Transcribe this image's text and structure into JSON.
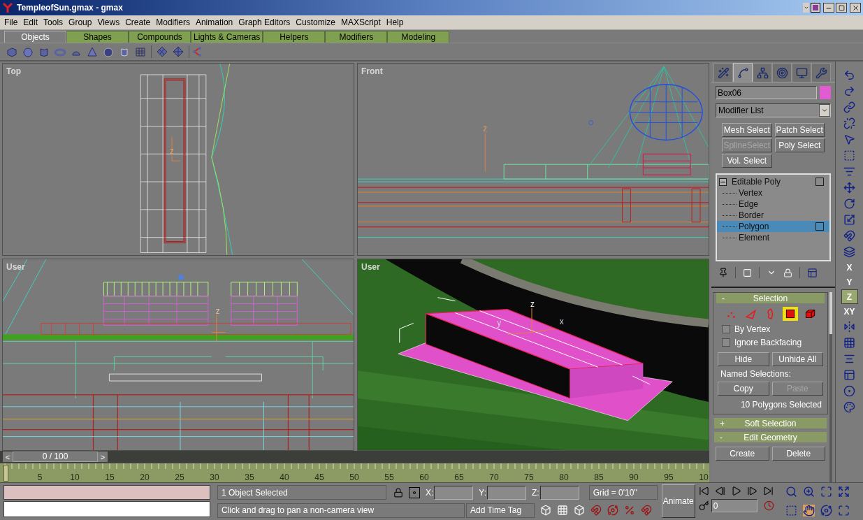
{
  "window": {
    "title": "TempleofSun.gmax - gmax"
  },
  "menu": [
    "File",
    "Edit",
    "Tools",
    "Group",
    "Views",
    "Create",
    "Modifiers",
    "Animation",
    "Graph Editors",
    "Customize",
    "MAXScript",
    "Help"
  ],
  "tabs": [
    {
      "label": "Objects",
      "selected": true
    },
    {
      "label": "Shapes",
      "selected": false
    },
    {
      "label": "Compounds",
      "selected": false
    },
    {
      "label": "Lights & Cameras",
      "selected": false
    },
    {
      "label": "Helpers",
      "selected": false
    },
    {
      "label": "Modifiers",
      "selected": false
    },
    {
      "label": "Modeling",
      "selected": false
    }
  ],
  "viewports": [
    {
      "label": "Top",
      "kind": "top",
      "gizmo_labels": [
        "z"
      ]
    },
    {
      "label": "Front",
      "kind": "front",
      "gizmo_labels": [
        "z"
      ]
    },
    {
      "label": "User",
      "kind": "user",
      "gizmo_labels": [
        "z"
      ]
    },
    {
      "label": "User",
      "kind": "shaded",
      "gizmo_labels": [
        "z",
        "y",
        "x"
      ]
    }
  ],
  "command_panel": {
    "tabs": [
      {
        "kind": "create",
        "selected": false
      },
      {
        "kind": "modify",
        "selected": true
      },
      {
        "kind": "hierarchy",
        "selected": false
      },
      {
        "kind": "motion",
        "selected": false
      },
      {
        "kind": "display",
        "selected": false
      },
      {
        "kind": "utilities",
        "selected": false
      }
    ],
    "object_name": "Box06",
    "object_swatch": {
      "color": "#e05cd0"
    },
    "modifier_list": "Modifier List",
    "modifier_buttons": [
      {
        "label": "Mesh Select",
        "disabled": false
      },
      {
        "label": "Patch Select",
        "disabled": false
      },
      {
        "label": "SplineSelect",
        "disabled": true
      },
      {
        "label": "Poly Select",
        "disabled": false
      },
      {
        "label": "Vol. Select",
        "disabled": false
      }
    ],
    "stack": {
      "label": "Editable Poly",
      "expanded": true,
      "children": [
        {
          "label": "Vertex",
          "selected": false
        },
        {
          "label": "Edge",
          "selected": false
        },
        {
          "label": "Border",
          "selected": false
        },
        {
          "label": "Polygon",
          "selected": true
        },
        {
          "label": "Element",
          "selected": false
        }
      ]
    },
    "selection_rollout": {
      "sign": "-",
      "title": "Selection",
      "levels": [
        {
          "kind": "vertex",
          "selected": false
        },
        {
          "kind": "edge",
          "selected": false
        },
        {
          "kind": "border",
          "selected": false
        },
        {
          "kind": "polygon",
          "selected": true
        },
        {
          "kind": "element",
          "selected": false
        }
      ],
      "options": [
        {
          "label": "By Vertex",
          "checked": false
        },
        {
          "label": "Ignore Backfacing",
          "checked": false
        }
      ],
      "buttons": [
        {
          "label": "Hide",
          "disabled": false
        },
        {
          "label": "Unhide All",
          "disabled": false
        }
      ],
      "named_label": "Named Selections:",
      "named_buttons": [
        {
          "label": "Copy",
          "disabled": false
        },
        {
          "label": "Paste",
          "disabled": true
        }
      ],
      "status": "10 Polygons Selected"
    },
    "soft_selection": {
      "sign": "+",
      "title": "Soft Selection"
    },
    "edit_geometry": {
      "sign": "-",
      "title": "Edit Geometry",
      "buttons": [
        {
          "label": "Create",
          "disabled": false
        },
        {
          "label": "Delete",
          "disabled": false
        }
      ]
    }
  },
  "axis_buttons": [
    {
      "label": "X",
      "selected": false
    },
    {
      "label": "Y",
      "selected": false
    },
    {
      "label": "Z",
      "selected": true
    },
    {
      "label": "XY",
      "selected": false
    }
  ],
  "time_slider": {
    "label": "0 / 100",
    "prev": "<",
    "next": ">"
  },
  "ruler_ticks": [
    "5",
    "10",
    "15",
    "20",
    "25",
    "30",
    "35",
    "40",
    "45",
    "50",
    "55",
    "60",
    "65",
    "70",
    "75",
    "80",
    "85",
    "90",
    "95",
    "10"
  ],
  "status": {
    "selection": "1 Object Selected",
    "prompt": "Click and drag to pan a non-camera view",
    "x_label": "X:",
    "y_label": "Y:",
    "z_label": "Z:",
    "grid": "Grid = 0'10''",
    "time_tag": "Add Time Tag",
    "animate": "Animate",
    "frame": "0"
  }
}
